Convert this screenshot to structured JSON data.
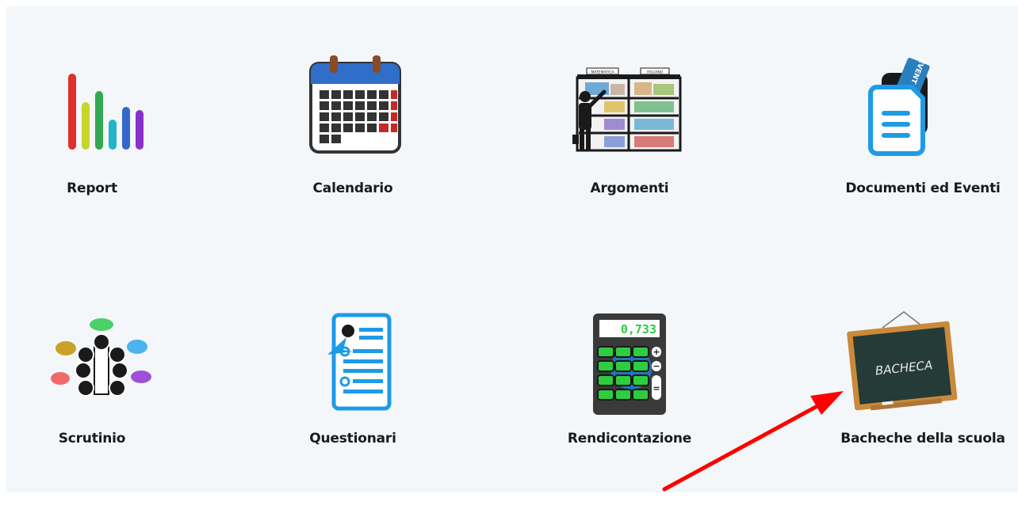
{
  "tiles": {
    "report": "Report",
    "calendario": "Calendario",
    "argomenti": "Argomenti",
    "documenti": "Documenti ed Eventi",
    "scrutinio": "Scrutinio",
    "questionari": "Questionari",
    "rendicontazione": "Rendicontazione",
    "bacheche": "Bacheche della scuola"
  },
  "icon_text": {
    "calculator_display": "0,733",
    "blackboard": "BACHECA",
    "doc_ticket": "EVENT",
    "shelf_left": "MATEMATICA",
    "shelf_right": "ITALIANO"
  },
  "colors": {
    "panel_background": "#f4f7fa",
    "arrow": "#ff0000",
    "doc_blue": "#1e9be6",
    "calendar_blue": "#2f6fc9"
  }
}
